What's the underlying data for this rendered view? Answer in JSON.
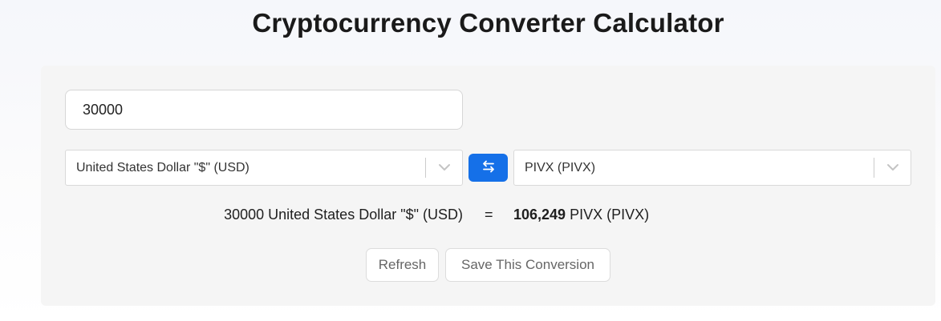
{
  "page": {
    "title": "Cryptocurrency Converter Calculator"
  },
  "converter": {
    "amount_value": "30000",
    "from_currency": "United States Dollar \"$\" (USD)",
    "to_currency": "PIVX (PIVX)",
    "swap_icon": "swap-arrows-icon",
    "chevron_icon": "chevron-down-icon"
  },
  "result": {
    "from_text": "30000 United States Dollar \"$\" (USD)",
    "equals": "=",
    "amount": "106,249",
    "to_unit": "PIVX (PIVX)"
  },
  "actions": {
    "refresh_label": "Refresh",
    "save_label": "Save This Conversion"
  },
  "colors": {
    "accent": "#1570e8",
    "panel_bg": "#f5f5f5"
  }
}
